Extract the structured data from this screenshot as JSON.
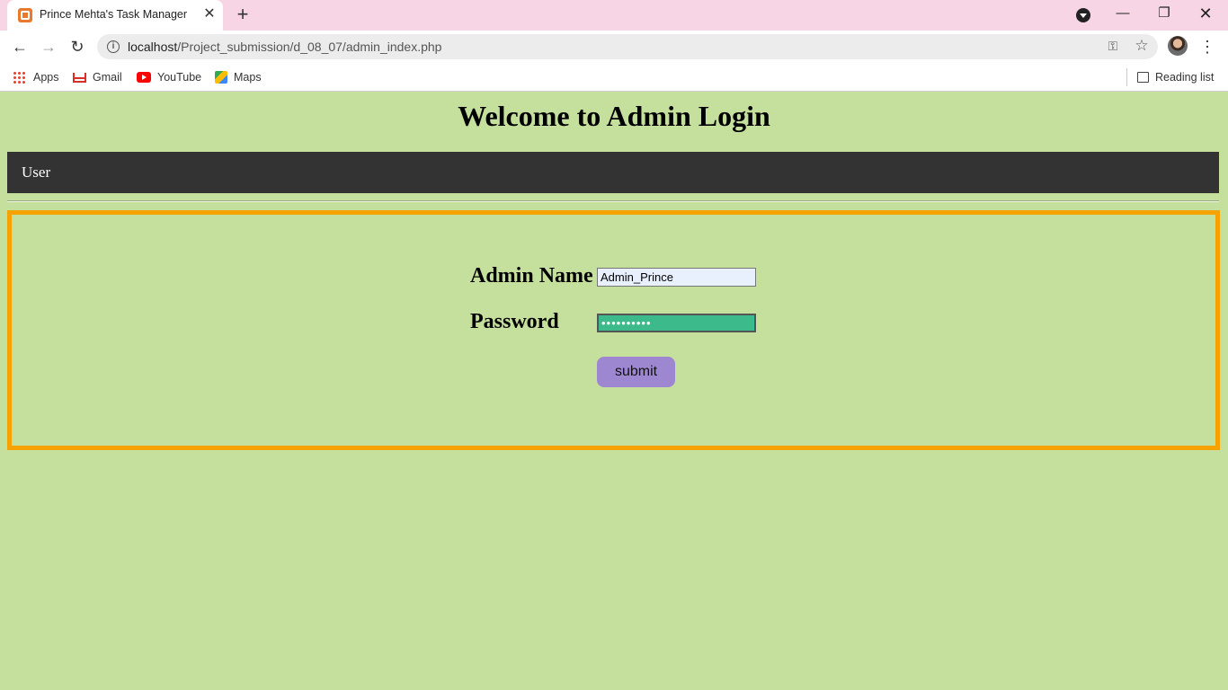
{
  "browser": {
    "tab_title": "Prince Mehta's Task Manager",
    "url_host": "localhost",
    "url_path": "/Project_submission/d_08_07/admin_index.php",
    "icons": {
      "tab_favicon": "xampp-icon",
      "close": "close-icon",
      "new_tab": "plus-icon",
      "back": "arrow-left-icon",
      "forward": "arrow-right-icon",
      "reload": "reload-icon",
      "info": "info-icon",
      "key": "key-icon",
      "star": "star-icon",
      "menu": "more-vert-icon"
    },
    "bookmarks": [
      {
        "label": "Apps",
        "icon": "apps-grid-icon"
      },
      {
        "label": "Gmail",
        "icon": "gmail-icon"
      },
      {
        "label": "YouTube",
        "icon": "youtube-icon"
      },
      {
        "label": "Maps",
        "icon": "maps-icon"
      }
    ],
    "reading_list": "Reading list"
  },
  "page": {
    "title": "Welcome to Admin Login",
    "nav": {
      "user_link": "User"
    },
    "form": {
      "admin_name_label": "Admin Name",
      "admin_name_value": "Admin_Prince",
      "password_label": "Password",
      "password_value": "••••••••••",
      "submit_label": "submit"
    }
  },
  "colors": {
    "page_bg": "#c5df9c",
    "navbar_bg": "#333333",
    "box_border": "#f5a300",
    "submit_bg": "#9d87d1",
    "password_bg": "#3cba8b",
    "titlebar_bg": "#f7d5e4"
  }
}
